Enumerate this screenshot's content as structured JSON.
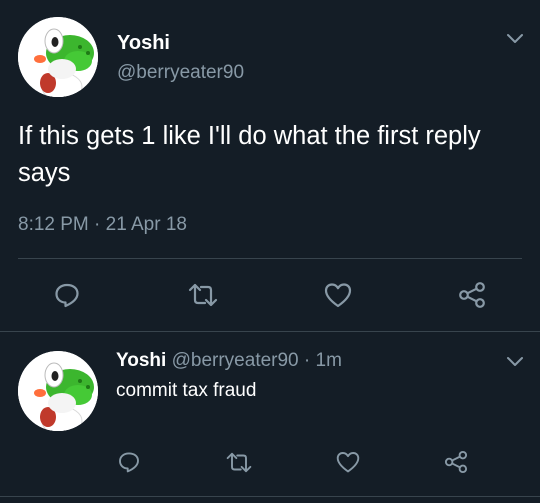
{
  "colors": {
    "background": "#141d26",
    "text": "#ffffff",
    "secondary": "#8899a6",
    "divider": "#38444d"
  },
  "tweet": {
    "name": "Yoshi",
    "handle": "@berryeater90",
    "text": "If this gets 1 like I'll do what the first  reply says",
    "time": "8:12 PM · 21 Apr 18",
    "actions": [
      "reply-icon",
      "retweet-icon",
      "like-icon",
      "share-icon"
    ],
    "menu_icon": "chevron-down-icon"
  },
  "reply": {
    "name": "Yoshi",
    "meta": "@berryeater90 · 1m",
    "text": "commit tax fraud",
    "actions": [
      "reply-icon",
      "retweet-icon",
      "like-icon",
      "share-icon"
    ],
    "menu_icon": "chevron-down-icon"
  }
}
